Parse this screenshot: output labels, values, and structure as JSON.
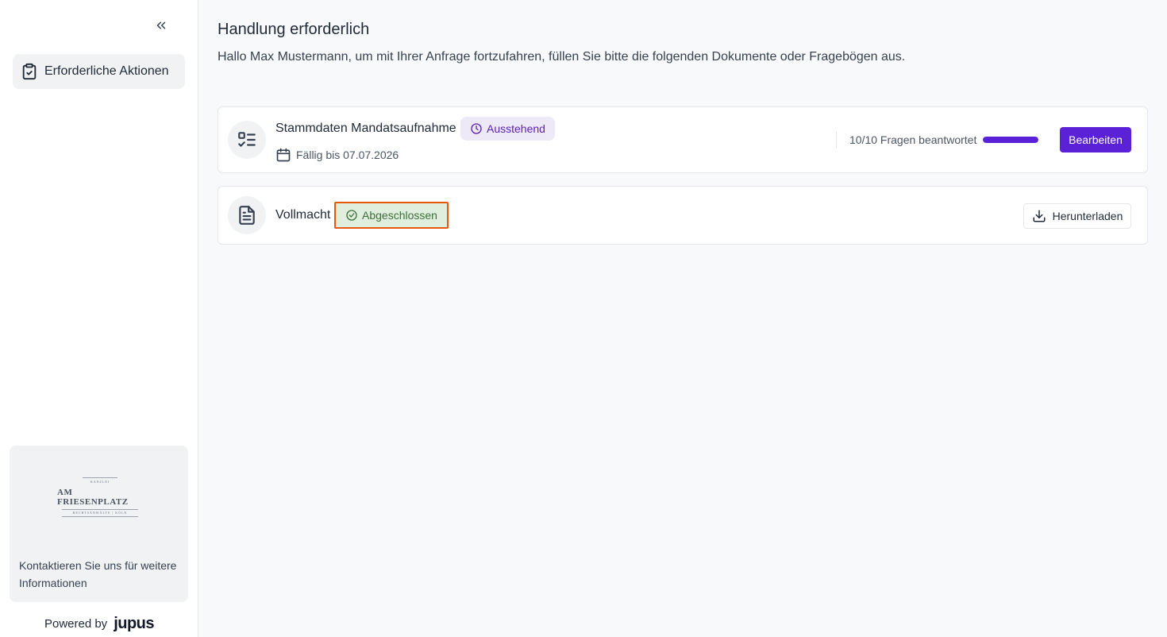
{
  "sidebar": {
    "nav_items": [
      {
        "label": "Erforderliche Aktionen",
        "icon": "clipboard-check-icon",
        "active": true
      }
    ],
    "logo": {
      "top_line": "KANZLEI",
      "name": "AM FRIESENPLATZ",
      "bottom_line": "RECHTSANWÄLTE | KÖLN"
    },
    "contact_text": "Kontaktieren Sie uns für weitere Informationen",
    "powered_by_label": "Powered by",
    "powered_by_brand": "jupus"
  },
  "main": {
    "title": "Handlung erforderlich",
    "subtitle": "Hallo Max Mustermann, um mit Ihrer Anfrage fortzufahren, füllen Sie bitte die folgenden Dokumente oder Fragebögen aus.",
    "documents": [
      {
        "title": "Stammdaten Mandatsaufnahme",
        "icon": "checklist-icon",
        "status": "Ausstehend",
        "due": "Fällig bis 07.07.2026",
        "progress_text": "10/10 Fragen beantwortet",
        "progress_fraction": 1.0,
        "action_label": "Bearbeiten"
      },
      {
        "title": "Vollmacht",
        "icon": "document-icon",
        "status": "Abgeschlossen",
        "action_label": "Herunterladen"
      }
    ]
  },
  "colors": {
    "accent": "#5b21d6",
    "pending_bg": "#ede9f7",
    "done_bg": "#dfeedd",
    "highlight_border": "#e8590c"
  }
}
